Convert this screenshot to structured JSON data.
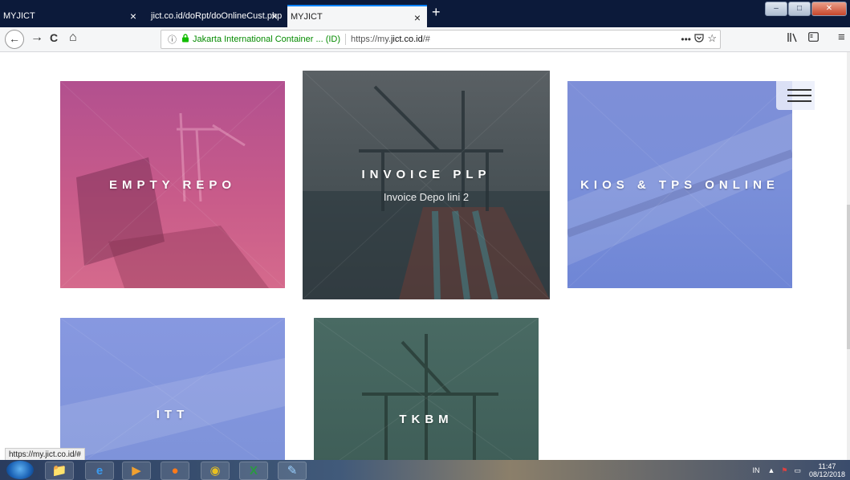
{
  "tabs": [
    {
      "label": "MYJICT",
      "active": false
    },
    {
      "label": "jict.co.id/doRpt/doOnlineCust.php",
      "active": false
    },
    {
      "label": "MYJICT",
      "active": true
    }
  ],
  "tab_close_glyph": "×",
  "new_tab_glyph": "+",
  "nav": {
    "back_glyph": "←",
    "forward_glyph": "→",
    "reload_glyph": "C",
    "home_glyph": "⌂"
  },
  "urlbar": {
    "info_glyph": "ⓘ",
    "site_identity": "Jakarta International Container ... (ID)",
    "url_prefix": "https://my.",
    "url_domain": "jict.co.id",
    "url_suffix": "/#",
    "more_glyph": "•••"
  },
  "cards": [
    {
      "title": "EMPTY REPO",
      "subtitle": ""
    },
    {
      "title": "INVOICE PLP",
      "subtitle": "Invoice Depo lini 2"
    },
    {
      "title": "KIOS & TPS ONLINE",
      "subtitle": ""
    },
    {
      "title": "ITT",
      "subtitle": ""
    },
    {
      "title": "TKBM",
      "subtitle": ""
    }
  ],
  "status_bar_url": "https://my.jict.co.id/#",
  "taskbar": {
    "tray_lang": "IN",
    "time": "11:47",
    "date": "08/12/2018"
  },
  "colors": {
    "empty_repo": "#c85b8a",
    "invoice_plp": "#4a5357",
    "kios": "#7a8fd9",
    "itt": "#8798e0",
    "tkbm": "#496a63"
  }
}
